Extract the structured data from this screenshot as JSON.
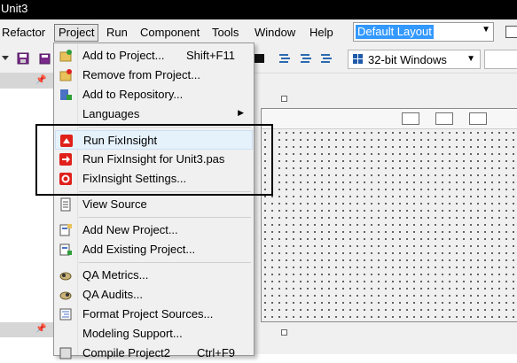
{
  "window": {
    "title": "Unit3"
  },
  "menubar": {
    "items": [
      {
        "label": "Refactor",
        "name": "menu-refactor"
      },
      {
        "label": "Project",
        "name": "menu-project",
        "active": true
      },
      {
        "label": "Run",
        "name": "menu-run"
      },
      {
        "label": "Component",
        "name": "menu-component"
      },
      {
        "label": "Tools",
        "name": "menu-tools"
      },
      {
        "label": "Window",
        "name": "menu-window"
      },
      {
        "label": "Help",
        "name": "menu-help"
      }
    ],
    "layout_combo": "Default Layout"
  },
  "toolbar": {
    "platform": "32-bit Windows"
  },
  "project_menu": {
    "items": [
      {
        "label": "Add to Project...",
        "shortcut": "Shift+F11",
        "icon": "add-to-project-icon"
      },
      {
        "label": "Remove from Project...",
        "icon": "remove-from-project-icon"
      },
      {
        "label": "Add to Repository...",
        "icon": "add-to-repository-icon"
      },
      {
        "label": "Languages",
        "submenu": true
      },
      {
        "label": "Run FixInsight",
        "icon": "fixinsight-icon",
        "highlighted": true
      },
      {
        "label": "Run FixInsight for Unit3.pas",
        "icon": "fixinsight-arrow-icon"
      },
      {
        "label": "FixInsight Settings...",
        "icon": "fixinsight-settings-icon"
      },
      {
        "label": "View Source",
        "icon": "view-source-icon"
      },
      {
        "label": "Add New Project...",
        "icon": "add-new-project-icon"
      },
      {
        "label": "Add Existing Project...",
        "icon": "add-existing-project-icon"
      },
      {
        "label": "QA Metrics...",
        "icon": "qa-metrics-icon"
      },
      {
        "label": "QA Audits...",
        "icon": "qa-audits-icon"
      },
      {
        "label": "Format Project Sources...",
        "icon": "format-sources-icon"
      },
      {
        "label": "Modeling Support..."
      },
      {
        "label": "Compile Project2",
        "shortcut": "Ctrl+F9",
        "icon": "compile-icon"
      }
    ]
  },
  "colors": {
    "highlight": "#e5f1fb",
    "selection": "#3399ff",
    "fixinsight_red": "#e0201b"
  }
}
